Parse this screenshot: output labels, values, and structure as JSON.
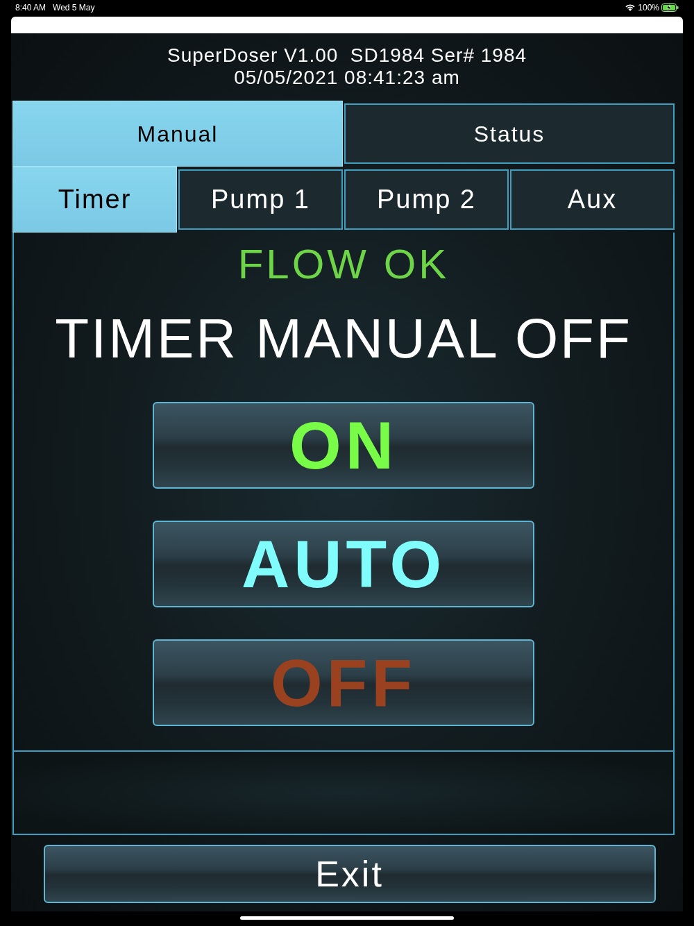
{
  "status_bar": {
    "time": "8:40 AM",
    "date": "Wed 5 May",
    "battery": "100%",
    "charging": true
  },
  "header": {
    "title": "SuperDoser V1.00  SD1984 Ser# 1984",
    "datetime": "05/05/2021 08:41:23 am"
  },
  "tabs": [
    {
      "label": "Manual",
      "selected": true
    },
    {
      "label": "Status",
      "selected": false
    }
  ],
  "sub_tabs": [
    {
      "label": "Timer",
      "selected": true
    },
    {
      "label": "Pump 1",
      "selected": false
    },
    {
      "label": "Pump 2",
      "selected": false
    },
    {
      "label": "Aux",
      "selected": false
    }
  ],
  "flow_status": "FLOW OK",
  "mode_title": "TIMER MANUAL OFF",
  "mode_buttons": [
    {
      "label": "ON",
      "kind": "on"
    },
    {
      "label": "AUTO",
      "kind": "auto"
    },
    {
      "label": "OFF",
      "kind": "off"
    }
  ],
  "exit_button": "Exit"
}
